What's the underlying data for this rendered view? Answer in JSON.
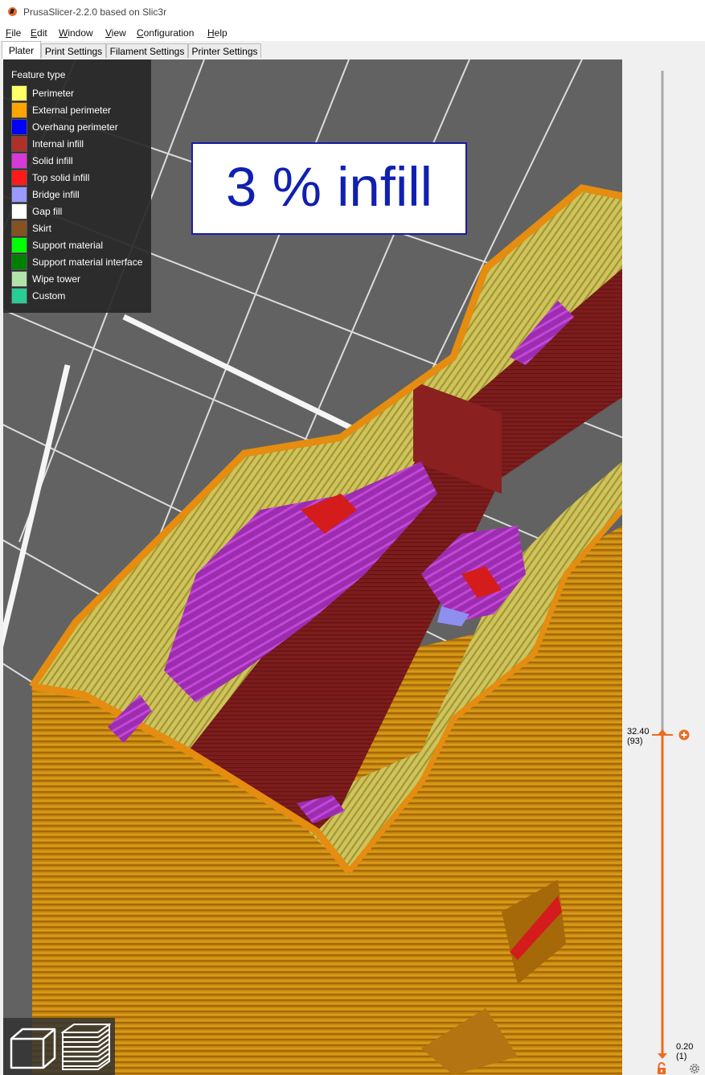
{
  "window": {
    "title": "PrusaSlicer-2.2.0 based on Slic3r"
  },
  "menu": [
    {
      "label": "File",
      "underline": "F",
      "rest": "ile"
    },
    {
      "label": "Edit",
      "underline": "E",
      "rest": "dit"
    },
    {
      "label": "Window",
      "underline": "W",
      "rest": "indow"
    },
    {
      "label": "View",
      "underline": "V",
      "rest": "iew"
    },
    {
      "label": "Configuration",
      "underline": "C",
      "rest": "onfiguration"
    },
    {
      "label": "Help",
      "underline": "H",
      "rest": "elp"
    }
  ],
  "tabs": [
    {
      "label": "Plater",
      "active": true
    },
    {
      "label": "Print Settings",
      "active": false
    },
    {
      "label": "Filament Settings",
      "active": false
    },
    {
      "label": "Printer Settings",
      "active": false
    }
  ],
  "legend": {
    "title": "Feature type",
    "items": [
      {
        "label": "Perimeter",
        "color": "#ffff66"
      },
      {
        "label": "External perimeter",
        "color": "#ffa500"
      },
      {
        "label": "Overhang perimeter",
        "color": "#0000ff"
      },
      {
        "label": "Internal infill",
        "color": "#b03029"
      },
      {
        "label": "Solid infill",
        "color": "#d63ad6"
      },
      {
        "label": "Top solid infill",
        "color": "#ff1a1a"
      },
      {
        "label": "Bridge infill",
        "color": "#9999ff"
      },
      {
        "label": "Gap fill",
        "color": "#ffffff"
      },
      {
        "label": "Skirt",
        "color": "#845321"
      },
      {
        "label": "Support material",
        "color": "#00ff00"
      },
      {
        "label": "Support material interface",
        "color": "#008000"
      },
      {
        "label": "Wipe tower",
        "color": "#b3e3ab"
      },
      {
        "label": "Custom",
        "color": "#28cc94"
      }
    ]
  },
  "annotation": {
    "text": "3 % infill"
  },
  "layer_slider": {
    "upper": {
      "height": "32.40",
      "layer": "(93)"
    },
    "lower": {
      "height": "0.20",
      "layer": "(1)"
    },
    "accent_color": "#ed6b21"
  },
  "view_buttons": [
    {
      "name": "3d-view-icon"
    },
    {
      "name": "preview-layers-icon"
    }
  ]
}
